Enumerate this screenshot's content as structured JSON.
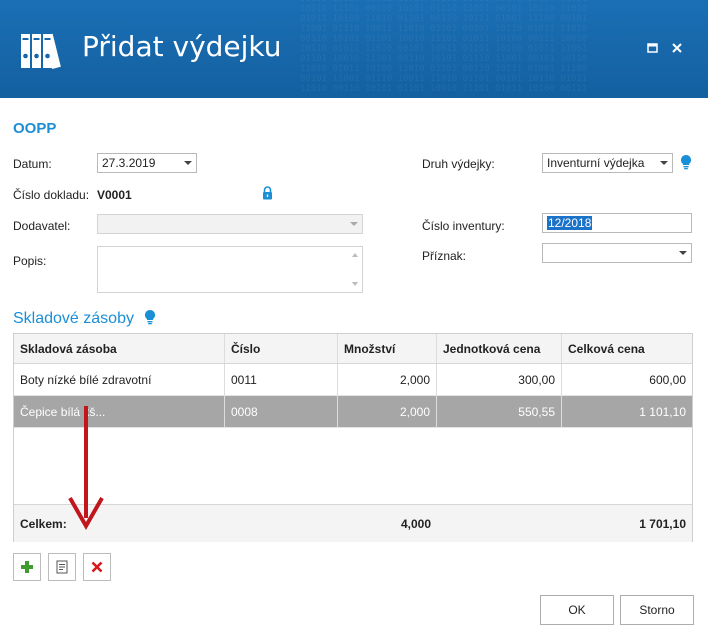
{
  "window": {
    "title": "Přidat výdejku"
  },
  "form": {
    "section_title": "OOPP",
    "datum_label": "Datum:",
    "datum_value": "27.3.2019",
    "cislo_dokladu_label": "Číslo dokladu:",
    "cislo_dokladu_value": "V0001",
    "dodavatel_label": "Dodavatel:",
    "dodavatel_value": "",
    "popis_label": "Popis:",
    "popis_value": "",
    "druh_label": "Druh výdejky:",
    "druh_value": "Inventurní výdejka",
    "cislo_inventury_label": "Číslo inventury:",
    "cislo_inventury_value": "12/2018",
    "priznak_label": "Příznak:",
    "priznak_value": ""
  },
  "grid": {
    "title": "Skladové zásoby",
    "columns": [
      "Skladová zásoba",
      "Číslo",
      "Množství",
      "Jednotková cena",
      "Celková cena"
    ],
    "rows": [
      {
        "name": "Boty nízké bílé zdravotní",
        "cislo": "0011",
        "mnozstvi": "2,000",
        "jednotkova": "300,00",
        "celkova": "600,00"
      },
      {
        "name": "Čepice bílá kš...",
        "cislo": "0008",
        "mnozstvi": "2,000",
        "jednotkova": "550,55",
        "celkova": "1 101,10"
      }
    ],
    "footer": {
      "label": "Celkem:",
      "mnozstvi": "4,000",
      "celkova": "1 701,10"
    }
  },
  "buttons": {
    "ok": "OK",
    "storno": "Storno"
  },
  "colors": {
    "titlebar": "#1565a8",
    "accent": "#1a8fd6",
    "selected_row": "#a6a6a6",
    "annotation_arrow": "#c0161c"
  }
}
